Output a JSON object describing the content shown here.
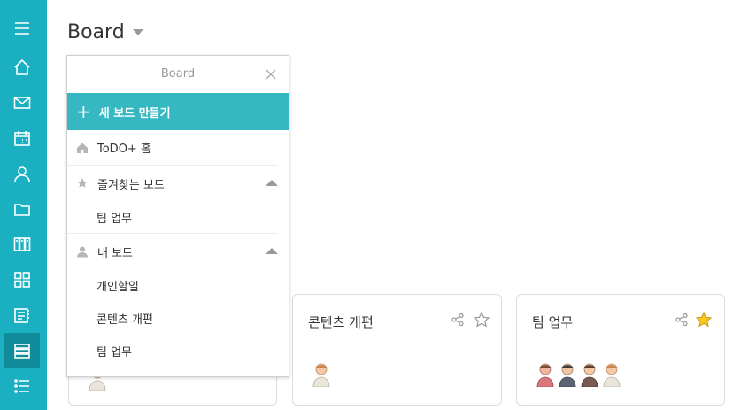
{
  "sidebar": {
    "items": [
      {
        "icon": "menu-icon"
      },
      {
        "icon": "home-icon"
      },
      {
        "icon": "mail-icon"
      },
      {
        "icon": "calendar-icon"
      },
      {
        "icon": "user-icon"
      },
      {
        "icon": "folder-icon"
      },
      {
        "icon": "binders-icon"
      },
      {
        "icon": "grid-icon"
      },
      {
        "icon": "notes-icon"
      },
      {
        "icon": "board-icon",
        "active": true
      },
      {
        "icon": "list-icon"
      }
    ],
    "color": "#1ab0c2",
    "active_color": "#118a9a"
  },
  "header": {
    "title": "Board"
  },
  "dropdown": {
    "title": "Board",
    "create_label": "새 보드 만들기",
    "home_label": "ToDO+ 홈",
    "favorites": {
      "label": "즐겨찾는 보드",
      "items": [
        "팀 업무"
      ]
    },
    "my_boards": {
      "label": "내 보드",
      "items": [
        "개인할일",
        "콘텐츠 개편",
        "팀 업무"
      ]
    },
    "accent": "#35b8c2"
  },
  "cards": [
    {
      "title": "콘텐츠 개편",
      "starred": false,
      "avatars": 1
    },
    {
      "title": "팀 업무",
      "starred": true,
      "avatars": 4
    }
  ]
}
